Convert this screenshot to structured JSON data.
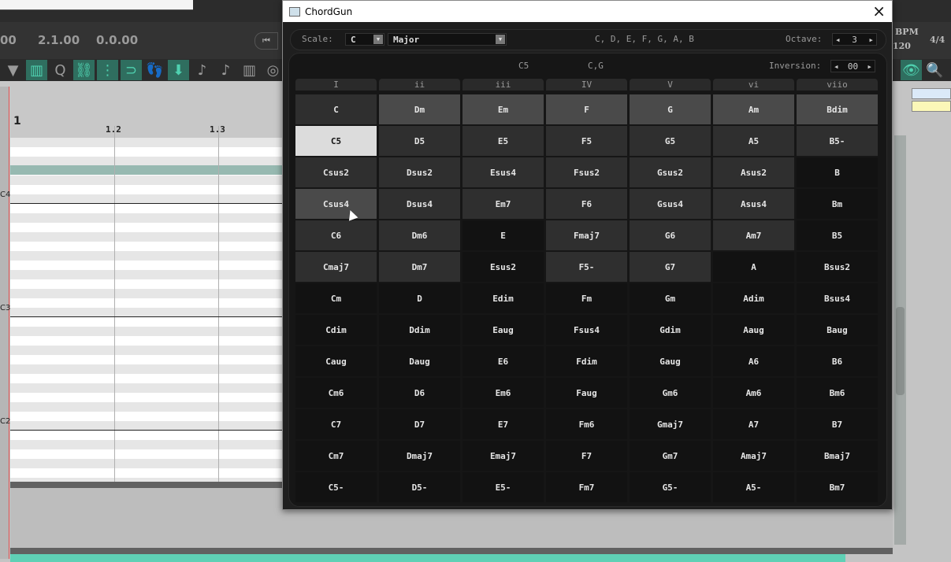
{
  "daw": {
    "times": [
      "00",
      "2.1.00",
      "0.0.00"
    ],
    "ruler": [
      "1",
      "1.2",
      "1.3"
    ],
    "keys": [
      "C4",
      "C3",
      "C2"
    ],
    "bpm_label": "BPM",
    "bpm": "120",
    "time_sig": "4/4"
  },
  "window": {
    "title": "ChordGun",
    "close": "×"
  },
  "scale": {
    "label": "Scale:",
    "tonic": "C",
    "type": "Major",
    "notes": "C, D, E, F, G, A, B",
    "octave_label": "Octave:",
    "octave": "3"
  },
  "chord_info": {
    "name": "C5",
    "notes": "C,G",
    "inversion_label": "Inversion:",
    "inversion": "00"
  },
  "degrees": [
    "I",
    "ii",
    "iii",
    "IV",
    "V",
    "vi",
    "viio"
  ],
  "grid": [
    [
      "C",
      "Dm",
      "Em",
      "F",
      "G",
      "Am",
      "Bdim"
    ],
    [
      "C5",
      "D5",
      "E5",
      "F5",
      "G5",
      "A5",
      "B5-"
    ],
    [
      "Csus2",
      "Dsus2",
      "Esus4",
      "Fsus2",
      "Gsus2",
      "Asus2",
      "B"
    ],
    [
      "Csus4",
      "Dsus4",
      "Em7",
      "F6",
      "Gsus4",
      "Asus4",
      "Bm"
    ],
    [
      "C6",
      "Dm6",
      "E",
      "Fmaj7",
      "G6",
      "Am7",
      "B5"
    ],
    [
      "Cmaj7",
      "Dm7",
      "Esus2",
      "F5-",
      "G7",
      "A",
      "Bsus2"
    ],
    [
      "Cm",
      "D",
      "Edim",
      "Fm",
      "Gm",
      "Adim",
      "Bsus4"
    ],
    [
      "Cdim",
      "Ddim",
      "Eaug",
      "Fsus4",
      "Gdim",
      "Aaug",
      "Baug"
    ],
    [
      "Caug",
      "Daug",
      "E6",
      "Fdim",
      "Gaug",
      "A6",
      "B6"
    ],
    [
      "Cm6",
      "D6",
      "Em6",
      "Faug",
      "Gm6",
      "Am6",
      "Bm6"
    ],
    [
      "C7",
      "D7",
      "E7",
      "Fm6",
      "Gmaj7",
      "A7",
      "B7"
    ],
    [
      "Cm7",
      "Dmaj7",
      "Emaj7",
      "F7",
      "Gm7",
      "Amaj7",
      "Bmaj7"
    ],
    [
      "C5-",
      "D5-",
      "E5-",
      "Fm7",
      "G5-",
      "A5-",
      "Bm7"
    ]
  ],
  "grid_states": [
    [
      "normal",
      "scale",
      "scale",
      "scale",
      "scale",
      "scale",
      "scale"
    ],
    [
      "selected",
      "normal",
      "normal",
      "normal",
      "normal",
      "normal",
      "normal"
    ],
    [
      "normal",
      "normal",
      "normal",
      "normal",
      "normal",
      "normal",
      "out"
    ],
    [
      "hover",
      "normal",
      "normal",
      "normal",
      "normal",
      "normal",
      "out"
    ],
    [
      "normal",
      "normal",
      "out",
      "normal",
      "normal",
      "normal",
      "out"
    ],
    [
      "normal",
      "normal",
      "out",
      "normal",
      "normal",
      "out",
      "out"
    ]
  ],
  "colors": {
    "scale_chord": "#4a4a4a",
    "in_key": "#2f2f2f",
    "out_of_key": "#121212",
    "selected": "#dcdcdc",
    "accent": "#4fd1b0"
  }
}
